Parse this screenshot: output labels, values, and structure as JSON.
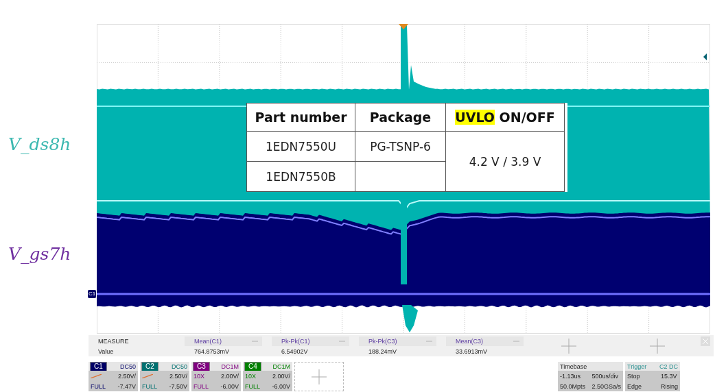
{
  "trace_labels": [
    {
      "text": "V_ds8h",
      "color": "#3cb8b0"
    },
    {
      "text": "V_gs7h",
      "color": "#7030a0"
    }
  ],
  "ground_marker": "C1",
  "table": {
    "headers": [
      {
        "text": "Part number"
      },
      {
        "text": "Package"
      },
      {
        "highlight": "UVLO",
        "text": "ON/OFF"
      }
    ],
    "parts": [
      {
        "part": "1EDN7550U",
        "package": "PG-TSNP-6"
      },
      {
        "part": "1EDN7550B"
      }
    ],
    "uvlo": "4.2 V / 3.9 V"
  },
  "measure": {
    "header": "MEASURE",
    "row_label": "Value",
    "items": [
      {
        "name": "Mean(C1)",
        "value": "764.8753mV"
      },
      {
        "name": "Pk-Pk(C1)",
        "value": "6.54902V"
      },
      {
        "name": "Pk-Pk(C3)",
        "value": "188.24mV"
      },
      {
        "name": "Mean(C3)",
        "value": "33.6913mV"
      }
    ]
  },
  "channels": [
    {
      "name": "C1",
      "coupling": "DC50",
      "scale": "2.50V/",
      "offset": "-7.47V",
      "bandwidth": "FULL",
      "color": "#000066"
    },
    {
      "name": "C2",
      "coupling": "DC50",
      "scale": "2.50V/",
      "offset": "-7.50V",
      "bandwidth": "FULL",
      "color": "#007070"
    },
    {
      "name": "C3",
      "coupling": "DC1M",
      "scale": "2.00V/",
      "offset": "-6.00V",
      "bandwidth": "FULL",
      "probe": "10X",
      "color": "#800080"
    },
    {
      "name": "C4",
      "coupling": "DC1M",
      "scale": "2.00V/",
      "offset": "-6.00V",
      "bandwidth": "FULL",
      "probe": "10X",
      "color": "#008000"
    }
  ],
  "timebase": {
    "title": "Timebase",
    "delay": "-1.13us",
    "scale": "500us/div",
    "memory": "50.0Mpts",
    "sample_rate": "2.50GSa/s"
  },
  "trigger": {
    "title": "Trigger",
    "source": "C2 DC",
    "state": "Stop",
    "trigger_level": "15.3V",
    "type": "Edge",
    "slope": "Rising"
  }
}
